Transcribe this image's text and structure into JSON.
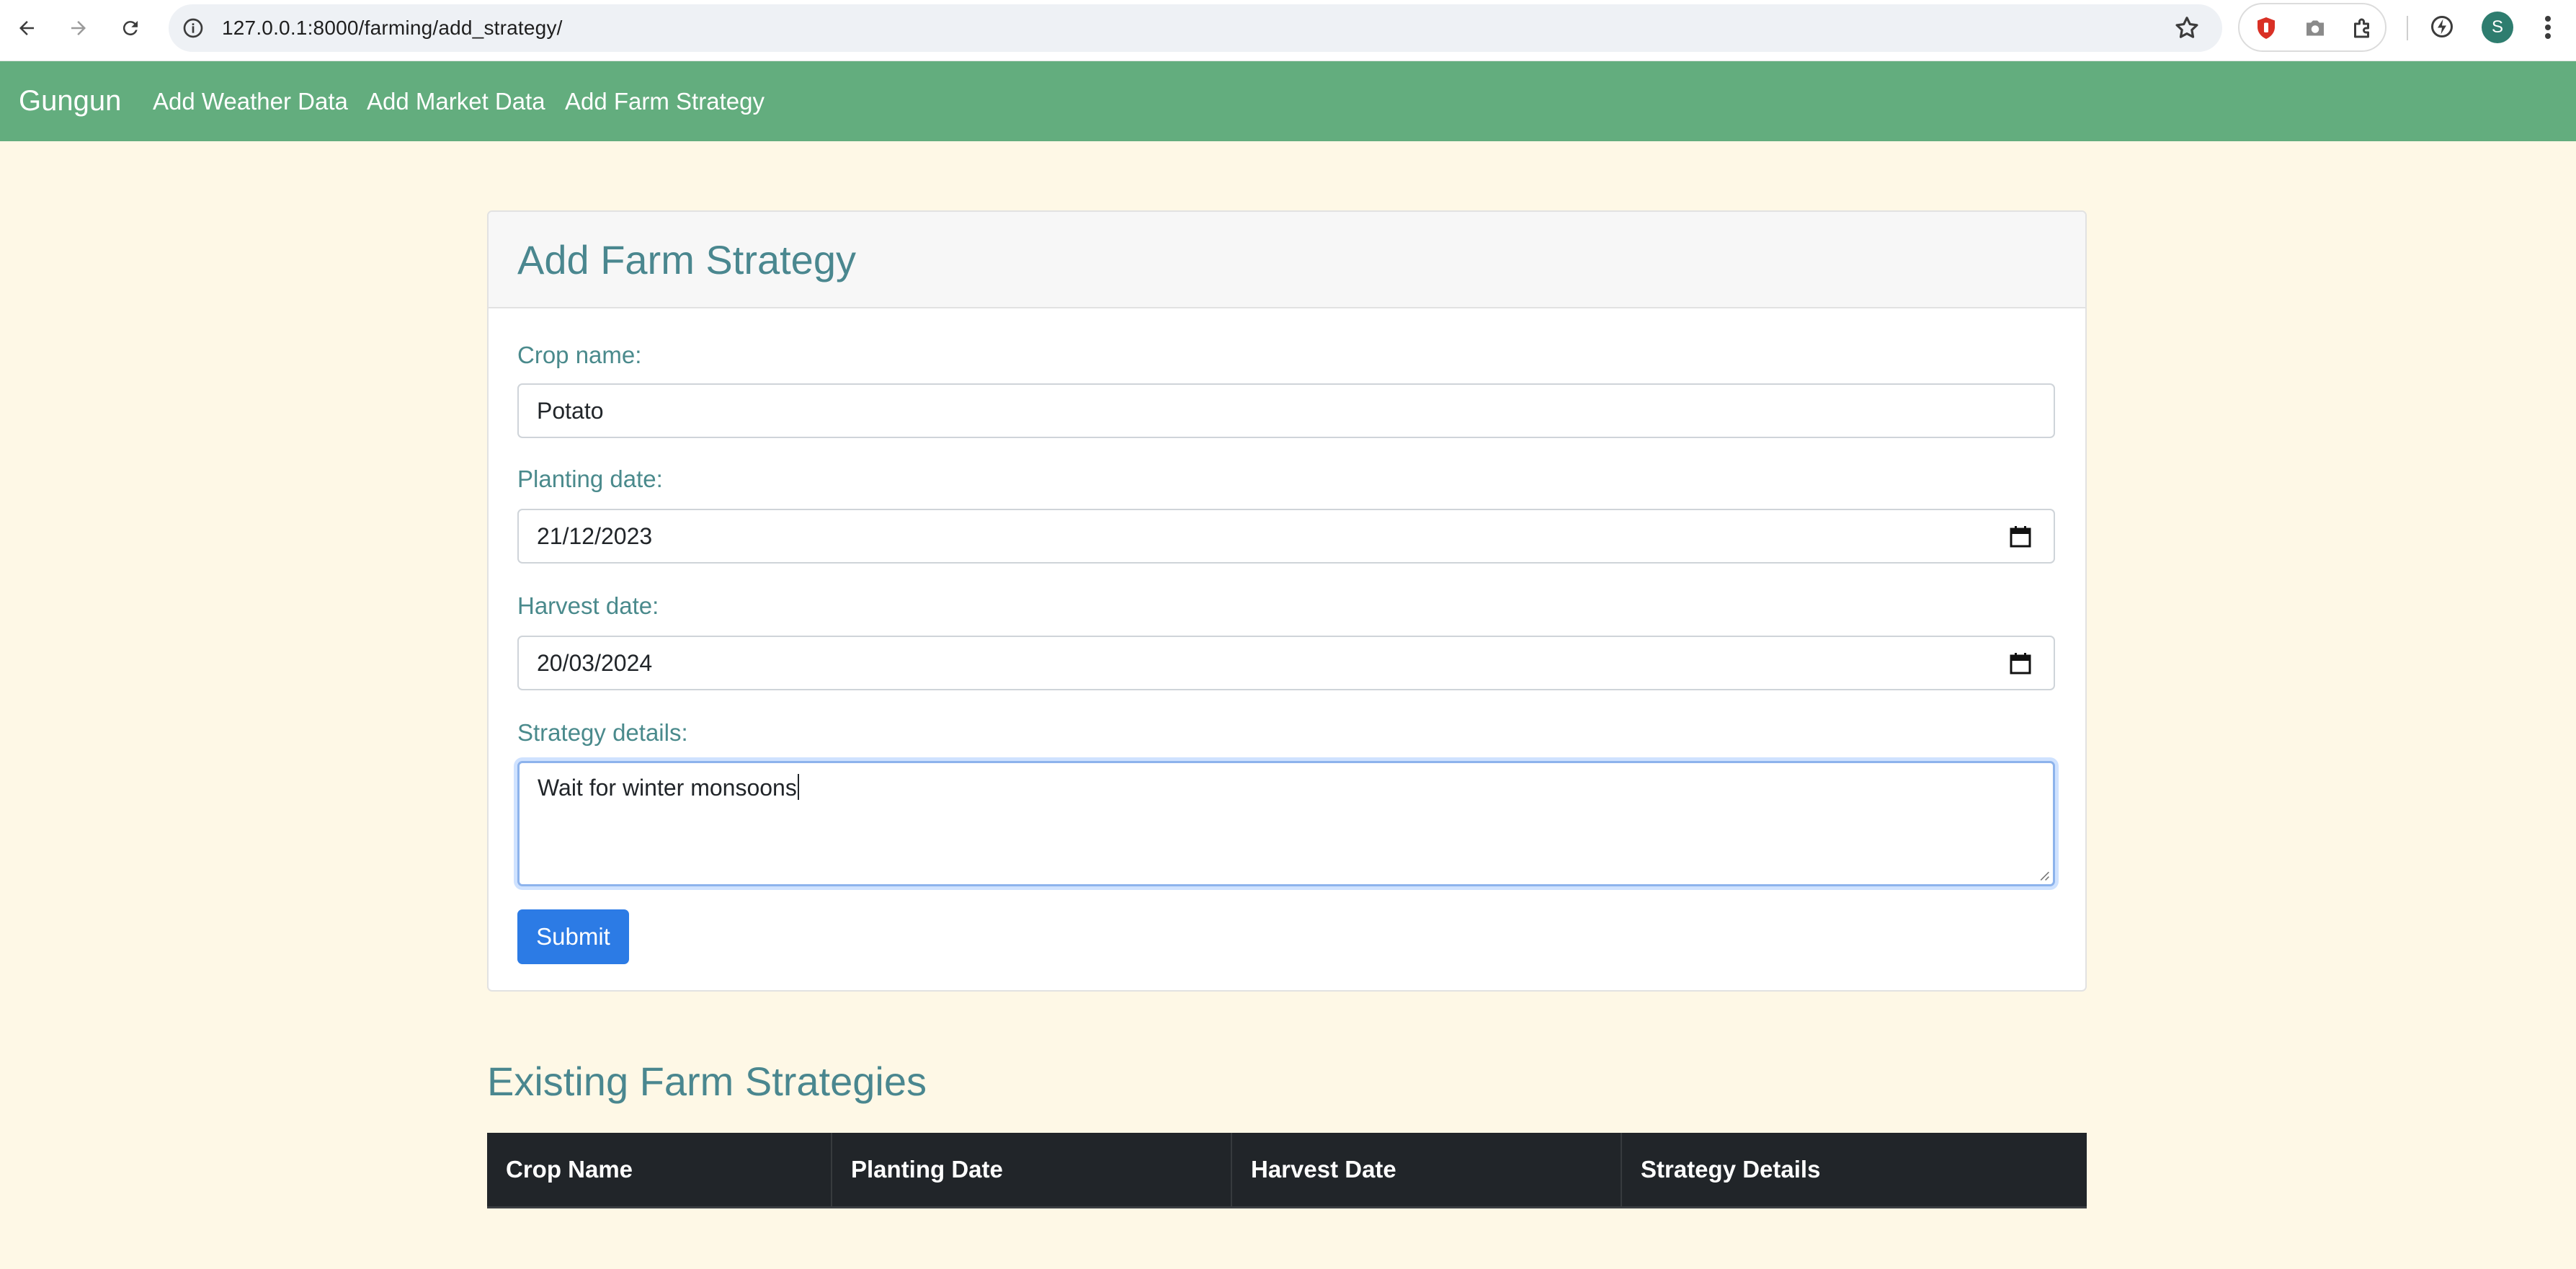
{
  "browser": {
    "url": "127.0.0.1:8000/farming/add_strategy/",
    "profile_initial": "S",
    "icons": [
      "back-arrow-icon",
      "forward-arrow-icon",
      "reload-icon",
      "site-info-icon",
      "bookmark-star-icon",
      "extension-red-icon",
      "camera-icon",
      "puzzle-icon",
      "performance-icon",
      "menu-dots-icon"
    ]
  },
  "navbar": {
    "brand": "Gungun",
    "links": [
      "Add Weather Data",
      "Add Market Data",
      "Add Farm Strategy"
    ],
    "bg_color": "#63ad7e"
  },
  "form": {
    "title": "Add Farm Strategy",
    "crop_name_label": "Crop name:",
    "crop_name_value": "Potato",
    "planting_date_label": "Planting date:",
    "planting_date_value": "21/12/2023",
    "harvest_date_label": "Harvest date:",
    "harvest_date_value": "20/03/2024",
    "strategy_details_label": "Strategy details:",
    "strategy_details_value": "Wait for winter monsoons",
    "submit_label": "Submit",
    "accent_color": "#2c7be5",
    "label_color": "#4a8a8c"
  },
  "existing": {
    "title": "Existing Farm Strategies",
    "columns": [
      "Crop Name",
      "Planting Date",
      "Harvest Date",
      "Strategy Details"
    ],
    "rows": []
  },
  "page_bg": "#fef8e6"
}
